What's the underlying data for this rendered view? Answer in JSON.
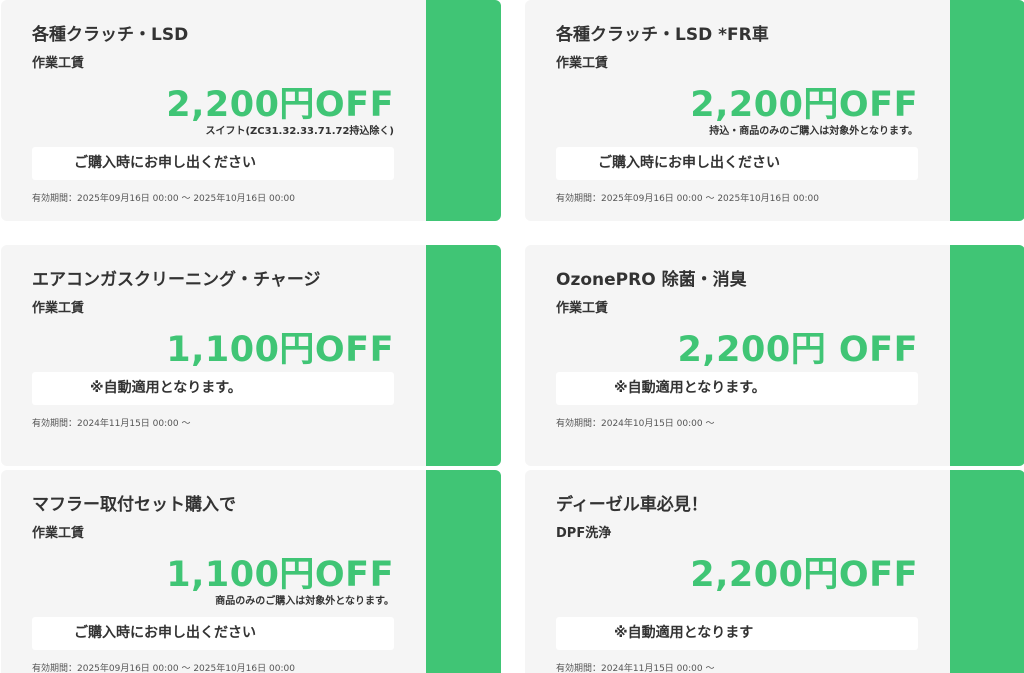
{
  "coupons": [
    {
      "title": "各種クラッチ・LSD",
      "subtitle": "作業工賃",
      "discount": "2,200円OFF",
      "note": "スイフト(ZC31.32.33.71.72持込除く)",
      "action": "ご購入時にお申し出ください",
      "validity": "有効期間：2025年09月16日 00:00 〜 2025年10月16日 00:00"
    },
    {
      "title": "各種クラッチ・LSD *FR車",
      "subtitle": "作業工賃",
      "discount": "2,200円OFF",
      "note": "持込・商品のみのご購入は対象外となります。",
      "action": "ご購入時にお申し出ください",
      "validity": "有効期間：2025年09月16日 00:00 〜 2025年10月16日 00:00"
    },
    {
      "title": "エアコンガスクリーニング・チャージ",
      "subtitle": "作業工賃",
      "discount": "1,100円OFF",
      "note": "",
      "action": "※自動適用となります。",
      "validity": "有効期間：2024年11月15日 00:00 〜"
    },
    {
      "title": "OzonePRO 除菌・消臭",
      "subtitle": "作業工賃",
      "discount": "2,200円 OFF",
      "note": "",
      "action": "※自動適用となります。",
      "validity": "有効期間：2024年10月15日 00:00 〜"
    },
    {
      "title": "マフラー取付セット購入で",
      "subtitle": "作業工賃",
      "discount": "1,100円OFF",
      "note": "商品のみのご購入は対象外となります。",
      "action": "ご購入時にお申し出ください",
      "validity": "有効期間：2025年09月16日 00:00 〜 2025年10月16日 00:00"
    },
    {
      "title": "ディーゼル車必見！",
      "subtitle": "DPF洗浄",
      "discount": "2,200円OFF",
      "note": "",
      "action": "※自動適用となります",
      "validity": "有効期間：2024年11月15日 00:00 〜"
    }
  ],
  "colors": {
    "accent": "#40c575",
    "card_background": "#f5f5f5",
    "text": "#333333"
  }
}
